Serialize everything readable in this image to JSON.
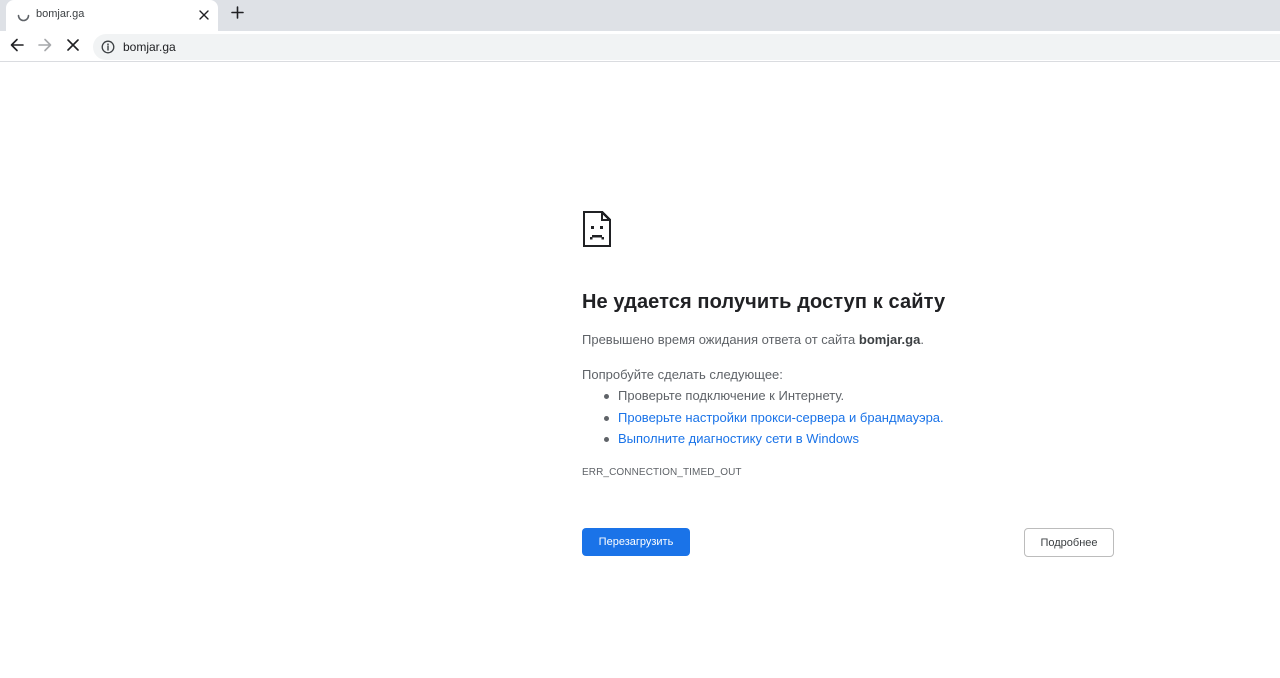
{
  "tab": {
    "title": "bomjar.ga",
    "spinner_icon": "loading-spinner-icon",
    "close_icon": "close-icon"
  },
  "new_tab": {
    "icon": "plus-icon"
  },
  "toolbar": {
    "back_icon": "arrow-back-icon",
    "forward_icon": "arrow-forward-icon",
    "stop_icon": "stop-icon",
    "info_icon": "info-icon",
    "url": "bomjar.ga"
  },
  "error": {
    "icon": "sad-page-icon",
    "title": "Не удается получить доступ к сайту",
    "description_prefix": "Превышено время ожидания ответа от сайта ",
    "host": "bomjar.ga",
    "description_suffix": ".",
    "try_heading": "Попробуйте сделать следующее:",
    "suggestions": [
      {
        "text": "Проверьте подключение к Интернету.",
        "link": false
      },
      {
        "text": "Проверьте настройки прокси-сервера и брандмауэра.",
        "link": true
      },
      {
        "text": "Выполните диагностику сети в Windows",
        "link": true
      }
    ],
    "code": "ERR_CONNECTION_TIMED_OUT",
    "reload_label": "Перезагрузить",
    "details_label": "Подробнее"
  },
  "colors": {
    "accent": "#1a73e8",
    "tabstrip": "#dee1e6",
    "omnibox": "#f1f3f4",
    "text_secondary": "#5f6368"
  }
}
